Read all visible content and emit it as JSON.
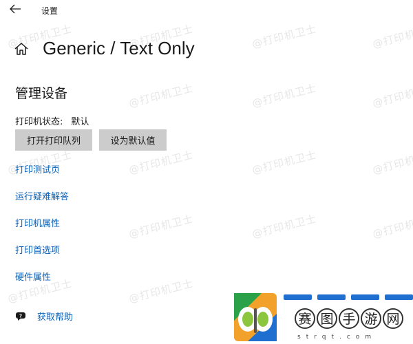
{
  "window": {
    "title": "设置"
  },
  "page": {
    "title": "Generic / Text Only"
  },
  "manage": {
    "section_title": "管理设备",
    "status_label": "打印机状态:",
    "status_value": "默认",
    "buttons": {
      "open_queue": "打开打印队列",
      "set_default": "设为默认值"
    }
  },
  "links": [
    "打印测试页",
    "运行疑难解答",
    "打印机属性",
    "打印首选项",
    "硬件属性"
  ],
  "help": {
    "label": "获取帮助"
  },
  "watermark": {
    "text": "@打印机卫士"
  },
  "corner_logo": {
    "chars": [
      "赛",
      "图",
      "手",
      "游",
      "网"
    ],
    "domain": "strqt.com"
  },
  "colors": {
    "link": "#0b62b8",
    "button_bg": "#cccccc",
    "text": "#1a1a1a",
    "background": "#ffffff"
  },
  "icons": {
    "back": "back-arrow-icon",
    "home": "home-icon",
    "help": "help-chat-icon"
  }
}
